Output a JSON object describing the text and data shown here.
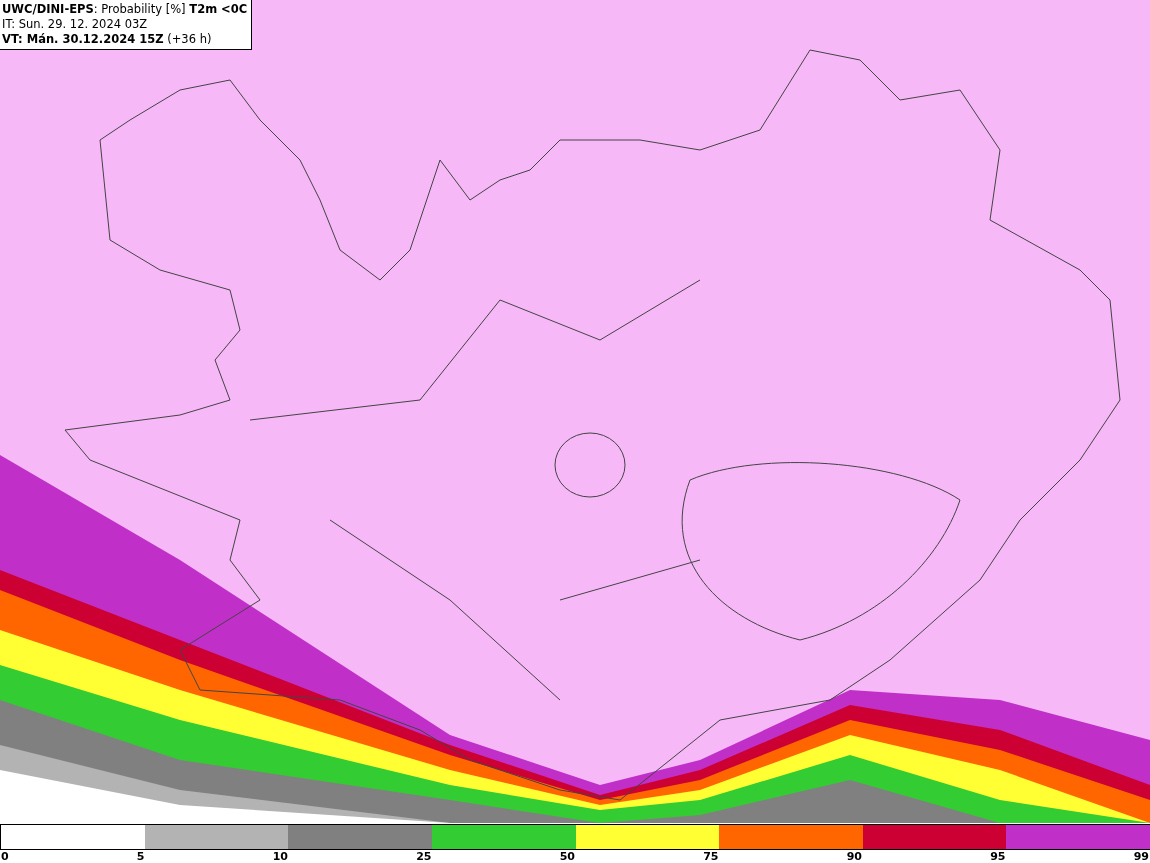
{
  "header": {
    "lines": [
      "**UWC/DINI-EPS**: Probability [%] **T2m <0C**",
      "IT: Sun. 29. 12. 2024 03Z",
      "**VT: Mán. 30.12.2024 15Z** (+36 h)"
    ]
  },
  "legend": {
    "segments": [
      {
        "color": "#ffffff"
      },
      {
        "color": "#b3b3b3"
      },
      {
        "color": "#808080"
      },
      {
        "color": "#33cc33"
      },
      {
        "color": "#ffff33"
      },
      {
        "color": "#ff6600"
      },
      {
        "color": "#cc0033"
      },
      {
        "color": "#c030c8"
      }
    ],
    "ticks": [
      "0",
      "5",
      "10",
      "25",
      "50",
      "75",
      "90",
      "95",
      "99"
    ]
  }
}
